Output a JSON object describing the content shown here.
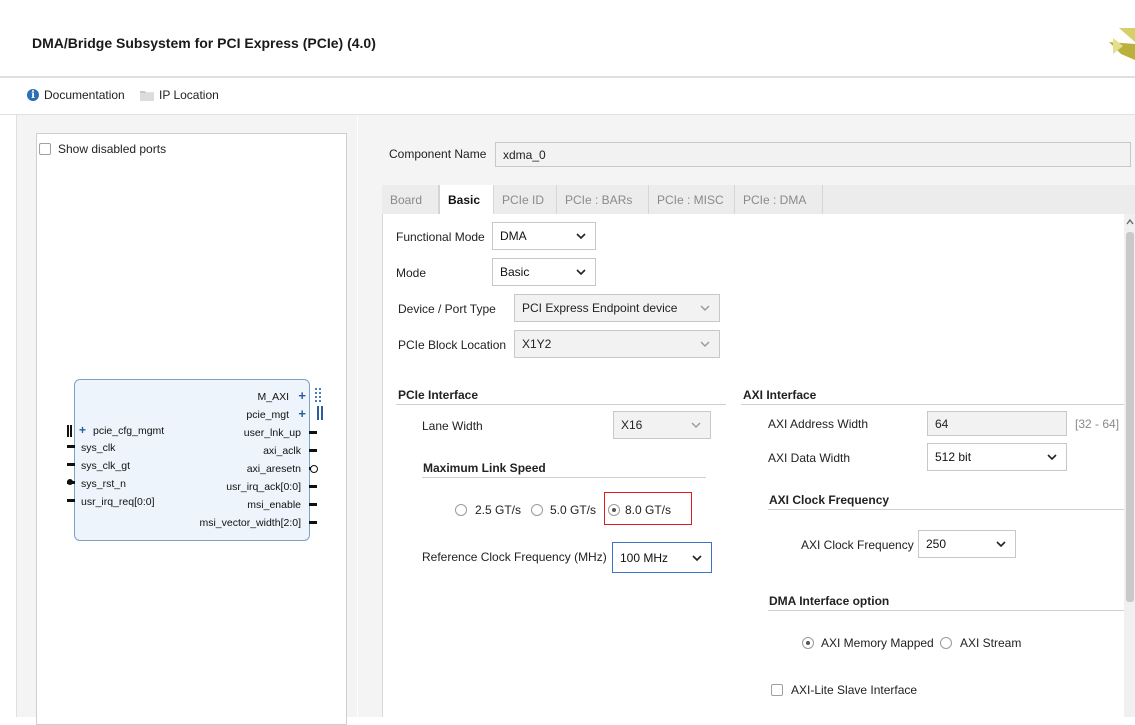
{
  "title": "DMA/Bridge Subsystem for PCI Express (PCIe) (4.0)",
  "toolbar": {
    "documentation": "Documentation",
    "ip_location": "IP Location"
  },
  "left": {
    "show_disabled_ports": "Show disabled ports",
    "block": {
      "left_ports": [
        "pcie_cfg_mgmt",
        "sys_clk",
        "sys_clk_gt",
        "sys_rst_n",
        "usr_irq_req[0:0]"
      ],
      "right_ports": [
        "M_AXI",
        "pcie_mgt",
        "user_lnk_up",
        "axi_aclk",
        "axi_aresetn",
        "usr_irq_ack[0:0]",
        "msi_enable",
        "msi_vector_width[2:0]"
      ]
    }
  },
  "component": {
    "label": "Component Name",
    "value": "xdma_0"
  },
  "tabs": [
    "Board",
    "Basic",
    "PCIe ID",
    "PCIe : BARs",
    "PCIe : MISC",
    "PCIe : DMA"
  ],
  "basic": {
    "functional_mode": {
      "label": "Functional Mode",
      "value": "DMA"
    },
    "mode": {
      "label": "Mode",
      "value": "Basic"
    },
    "device_port_type": {
      "label": "Device / Port Type",
      "value": "PCI Express Endpoint device"
    },
    "block_location": {
      "label": "PCIe Block Location",
      "value": "X1Y2"
    }
  },
  "pcie_interface": {
    "title": "PCIe Interface",
    "lane_width": {
      "label": "Lane Width",
      "value": "X16"
    },
    "max_link_speed": {
      "title": "Maximum Link Speed",
      "options": [
        "2.5 GT/s",
        "5.0 GT/s",
        "8.0 GT/s"
      ],
      "selected": "8.0 GT/s"
    },
    "ref_clock": {
      "label": "Reference Clock Frequency (MHz)",
      "value": "100 MHz"
    }
  },
  "axi_interface": {
    "title": "AXI Interface",
    "address_width": {
      "label": "AXI Address Width",
      "value": "64",
      "range": "[32 - 64]"
    },
    "data_width": {
      "label": "AXI Data Width",
      "value": "512 bit"
    },
    "clock_section": "AXI Clock Frequency",
    "clock": {
      "label": "AXI Clock Frequency",
      "value": "250"
    },
    "dma_section": "DMA Interface option",
    "dma_options": [
      "AXI Memory Mapped",
      "AXI Stream"
    ],
    "dma_selected": "AXI Memory Mapped",
    "axi_lite": "AXI-Lite Slave Interface"
  },
  "colors": {
    "highlight_red": "#e0191e",
    "focus_blue": "#3b73c6",
    "block_fill": "#edf4fb",
    "accent_blue": "#2a6fb3"
  }
}
